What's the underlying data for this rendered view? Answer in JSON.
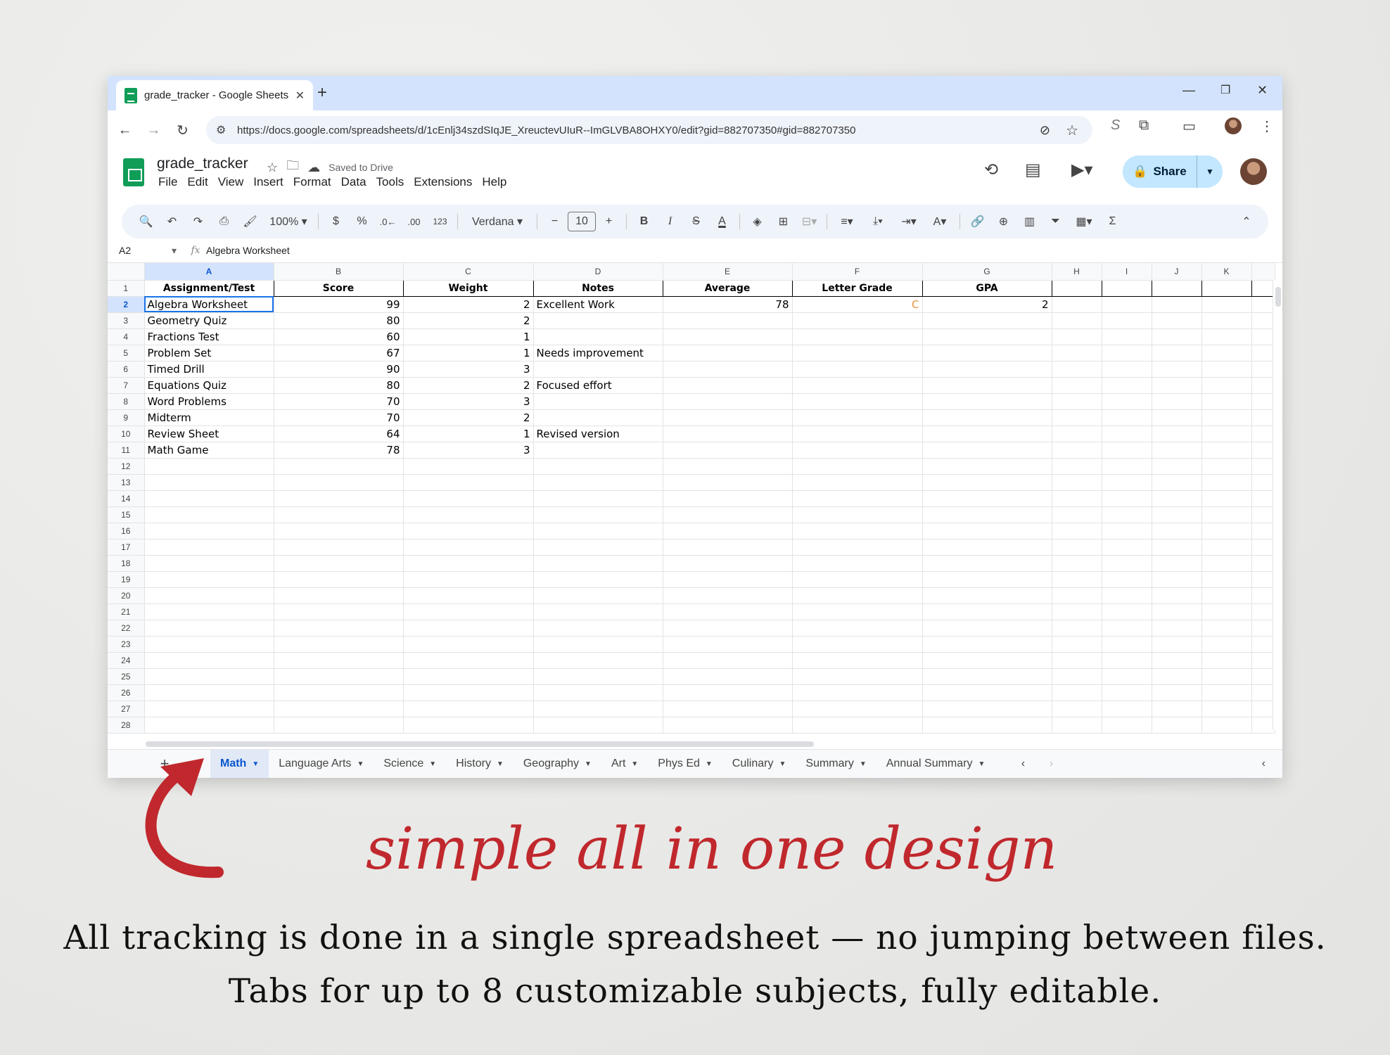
{
  "browser": {
    "tab_title": "grade_tracker - Google Sheets",
    "url": "https://docs.google.com/spreadsheets/d/1cEnlj34szdSIqJE_XreuctevUIuR--ImGLVBA8OHXY0/edit?gid=882707350#gid=882707350"
  },
  "sheet": {
    "doc_title": "grade_tracker",
    "saved_status": "Saved to Drive",
    "menu": [
      "File",
      "Edit",
      "View",
      "Insert",
      "Format",
      "Data",
      "Tools",
      "Extensions",
      "Help"
    ],
    "share_label": "Share",
    "zoom": "100%",
    "font": "Verdana",
    "font_size": "10",
    "name_box": "A2",
    "formula_value": "Algebra Worksheet"
  },
  "grid": {
    "columns": [
      "A",
      "B",
      "C",
      "D",
      "E",
      "F",
      "G",
      "H",
      "I",
      "J",
      "K"
    ],
    "headers": [
      "Assignment/Test",
      "Score",
      "Weight",
      "Notes",
      "Average",
      "Letter Grade",
      "GPA"
    ],
    "rows": [
      {
        "assignment": "Algebra Worksheet",
        "score": "99",
        "weight": "2",
        "notes": "Excellent Work",
        "average": "78",
        "letter": "C",
        "gpa": "2"
      },
      {
        "assignment": "Geometry Quiz",
        "score": "80",
        "weight": "2",
        "notes": "",
        "average": "",
        "letter": "",
        "gpa": ""
      },
      {
        "assignment": "Fractions Test",
        "score": "60",
        "weight": "1",
        "notes": "",
        "average": "",
        "letter": "",
        "gpa": ""
      },
      {
        "assignment": "Problem Set",
        "score": "67",
        "weight": "1",
        "notes": "Needs improvement",
        "average": "",
        "letter": "",
        "gpa": ""
      },
      {
        "assignment": "Timed Drill",
        "score": "90",
        "weight": "3",
        "notes": "",
        "average": "",
        "letter": "",
        "gpa": ""
      },
      {
        "assignment": "Equations Quiz",
        "score": "80",
        "weight": "2",
        "notes": "Focused effort",
        "average": "",
        "letter": "",
        "gpa": ""
      },
      {
        "assignment": "Word Problems",
        "score": "70",
        "weight": "3",
        "notes": "",
        "average": "",
        "letter": "",
        "gpa": ""
      },
      {
        "assignment": "Midterm",
        "score": "70",
        "weight": "2",
        "notes": "",
        "average": "",
        "letter": "",
        "gpa": ""
      },
      {
        "assignment": "Review Sheet",
        "score": "64",
        "weight": "1",
        "notes": "Revised version",
        "average": "",
        "letter": "",
        "gpa": ""
      },
      {
        "assignment": "Math Game",
        "score": "78",
        "weight": "3",
        "notes": "",
        "average": "",
        "letter": "",
        "gpa": ""
      }
    ],
    "row_numbers": [
      "1",
      "2",
      "3",
      "4",
      "5",
      "6",
      "7",
      "8",
      "9",
      "10",
      "11",
      "12",
      "13",
      "14",
      "15",
      "16",
      "17",
      "18",
      "19",
      "20",
      "21",
      "22",
      "23",
      "24",
      "25",
      "26",
      "27",
      "28"
    ]
  },
  "sheet_tabs": [
    "Math",
    "Language Arts",
    "Science",
    "History",
    "Geography",
    "Art",
    "Phys Ed",
    "Culinary",
    "Summary",
    "Annual Summary"
  ],
  "active_tab": "Math",
  "overlay": {
    "script_text": "simple all in one design",
    "caption_line1": "All tracking is done in a single spreadsheet — no jumping between files.",
    "caption_line2": "Tabs for up to 8 customizable subjects, fully editable."
  },
  "colors": {
    "accent_red": "#c0282d",
    "letter_grade_orange": "#e69138",
    "selection_blue": "#1a73e8"
  }
}
